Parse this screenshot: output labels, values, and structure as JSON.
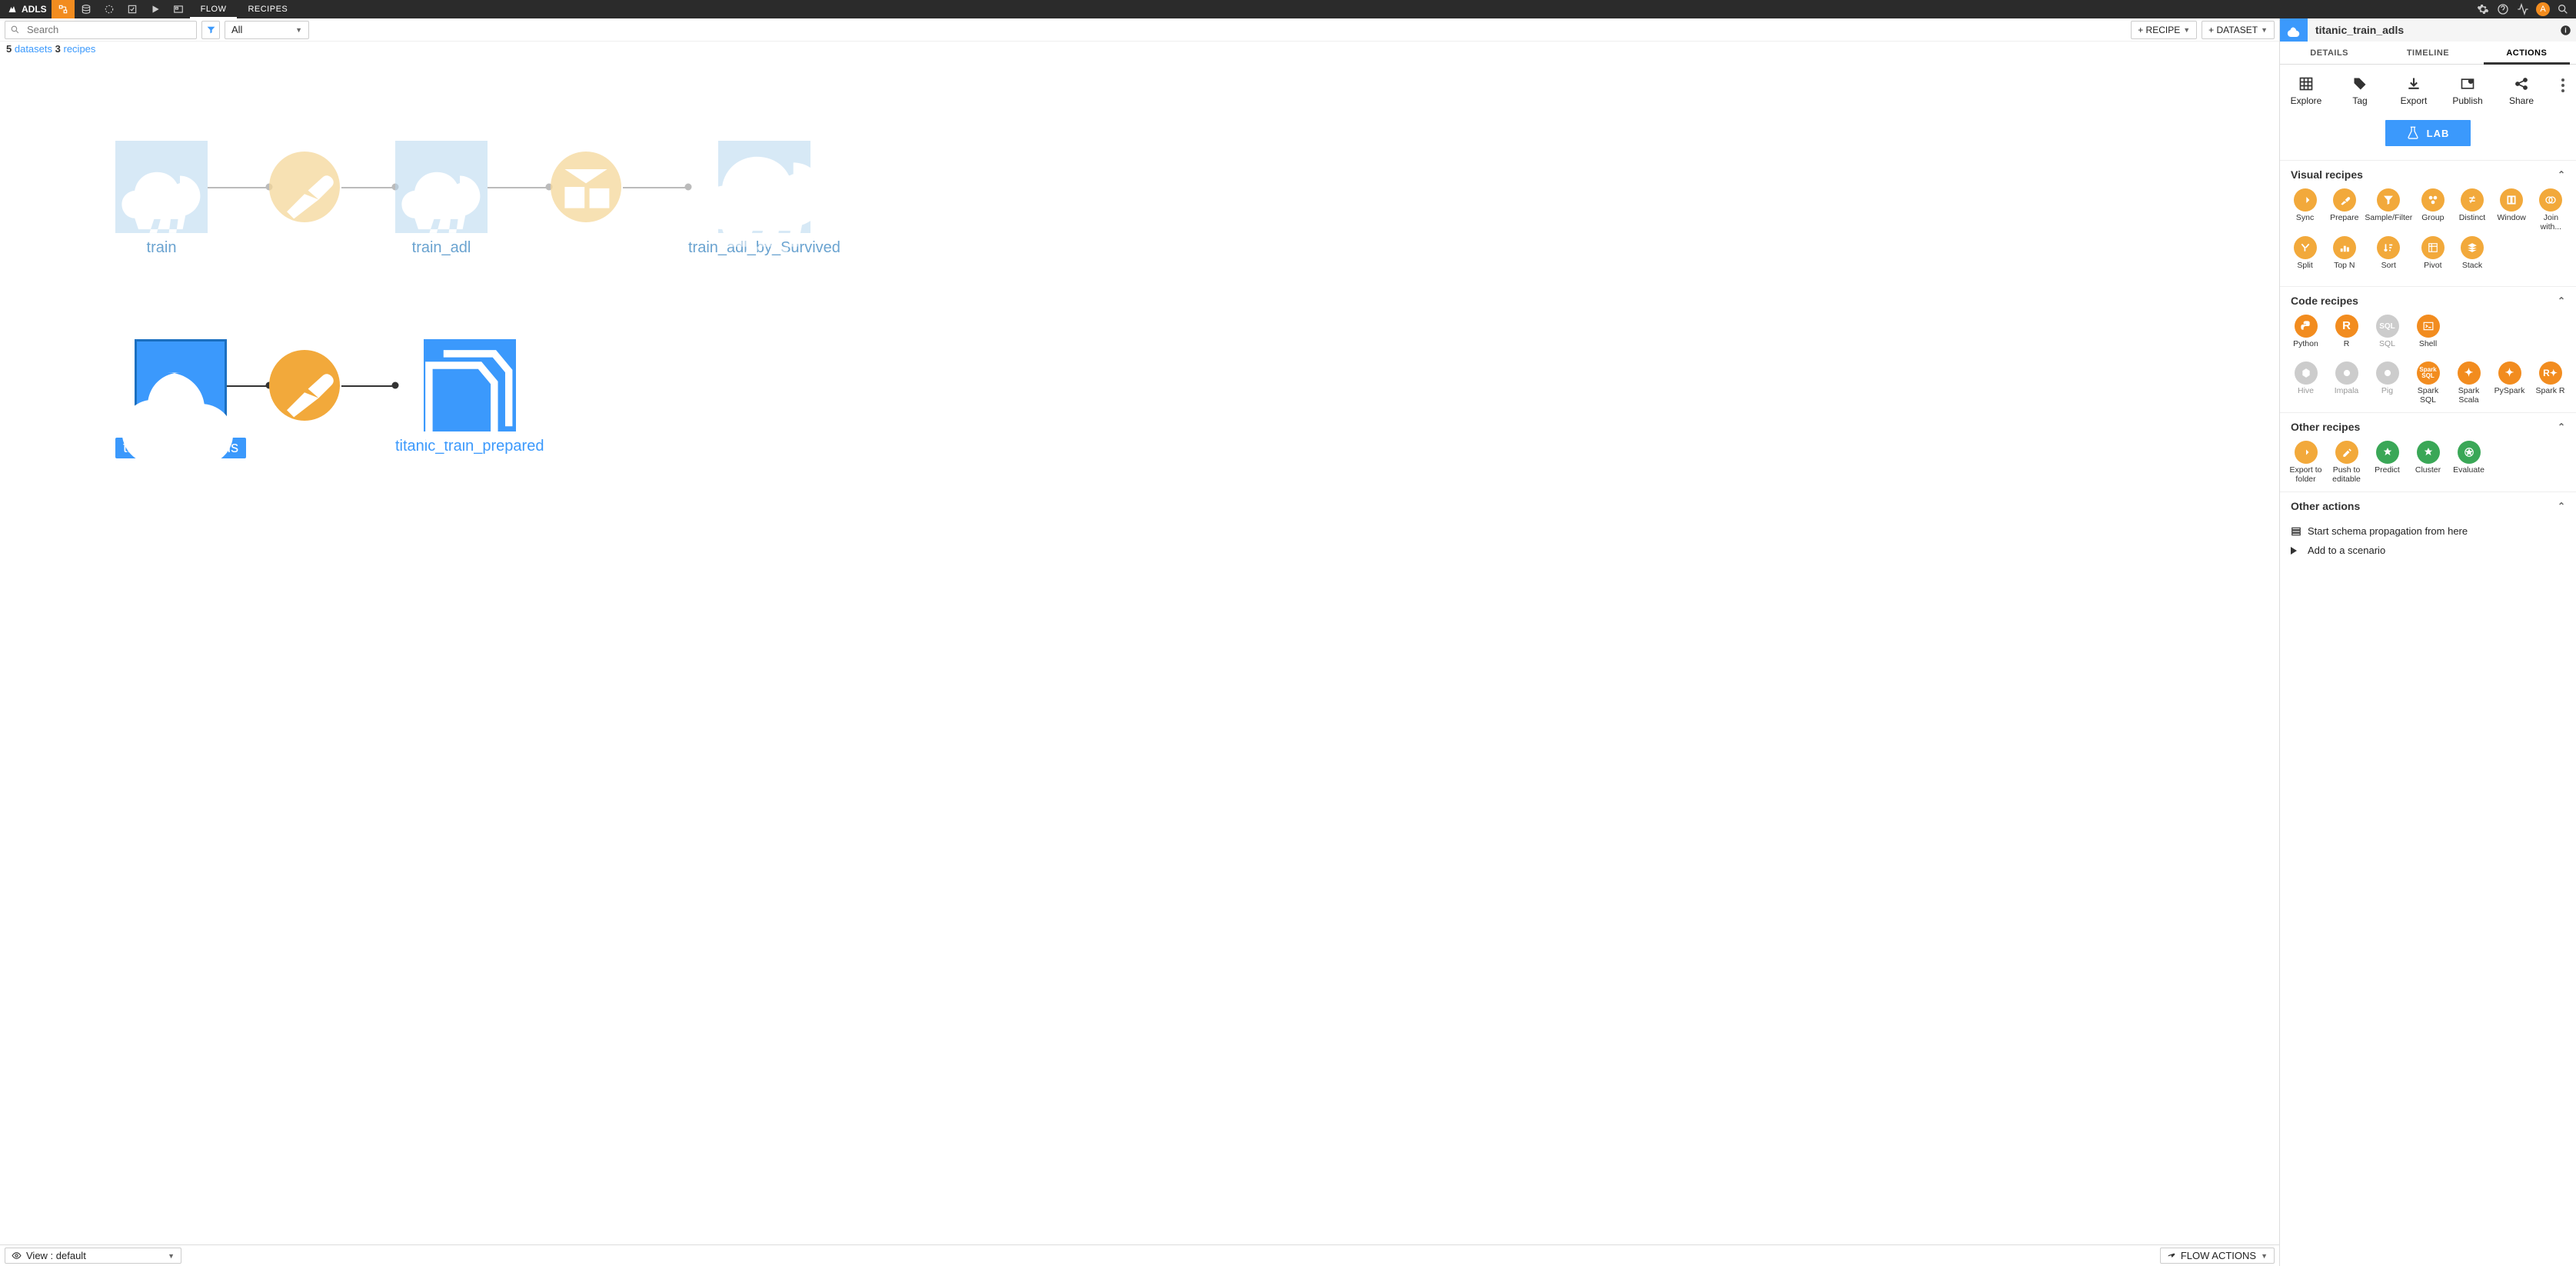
{
  "topnav": {
    "project": "ADLS",
    "items": [
      "FLOW",
      "RECIPES"
    ],
    "active": "FLOW",
    "avatar": "A"
  },
  "toolbar": {
    "search_placeholder": "Search",
    "filter_all": "All",
    "add_recipe": "+ RECIPE",
    "add_dataset": "+ DATASET"
  },
  "summary": {
    "ds_count": "5",
    "ds_label": "datasets",
    "rc_count": "3",
    "rc_label": "recipes"
  },
  "footer": {
    "view_label": "View : default",
    "flow_actions": "FLOW ACTIONS"
  },
  "rpanel": {
    "title": "titanic_train_adls",
    "tabs": {
      "details": "DETAILS",
      "timeline": "TIMELINE",
      "actions": "ACTIONS"
    },
    "actionbtns": {
      "explore": "Explore",
      "tag": "Tag",
      "export": "Export",
      "publish": "Publish",
      "share": "Share"
    },
    "lab": "LAB",
    "section_visual": "Visual recipes",
    "visual": [
      "Sync",
      "Prepare",
      "Sample/Filter",
      "Group",
      "Distinct",
      "Window",
      "Join with...",
      "Split",
      "Top N",
      "Sort",
      "Pivot",
      "Stack"
    ],
    "section_code": "Code recipes",
    "code": [
      "Python",
      "R",
      "SQL",
      "Shell",
      "Hive",
      "Impala",
      "Pig",
      "Spark SQL",
      "Spark Scala",
      "PySpark",
      "Spark R"
    ],
    "section_other": "Other recipes",
    "other": [
      "Export to folder",
      "Push to editable",
      "Predict",
      "Cluster",
      "Evaluate"
    ],
    "section_otheract": "Other actions",
    "oact1": "Start schema propagation from here",
    "oact2": "Add to a scenario"
  },
  "flow": {
    "train": "train",
    "train_adl": "train_adl",
    "train_adl_by": "train_adl_by_Survived",
    "titanic_train_adls": "titanic_train_adls",
    "titanic_train_prepared": "titanic_train_prepared"
  }
}
